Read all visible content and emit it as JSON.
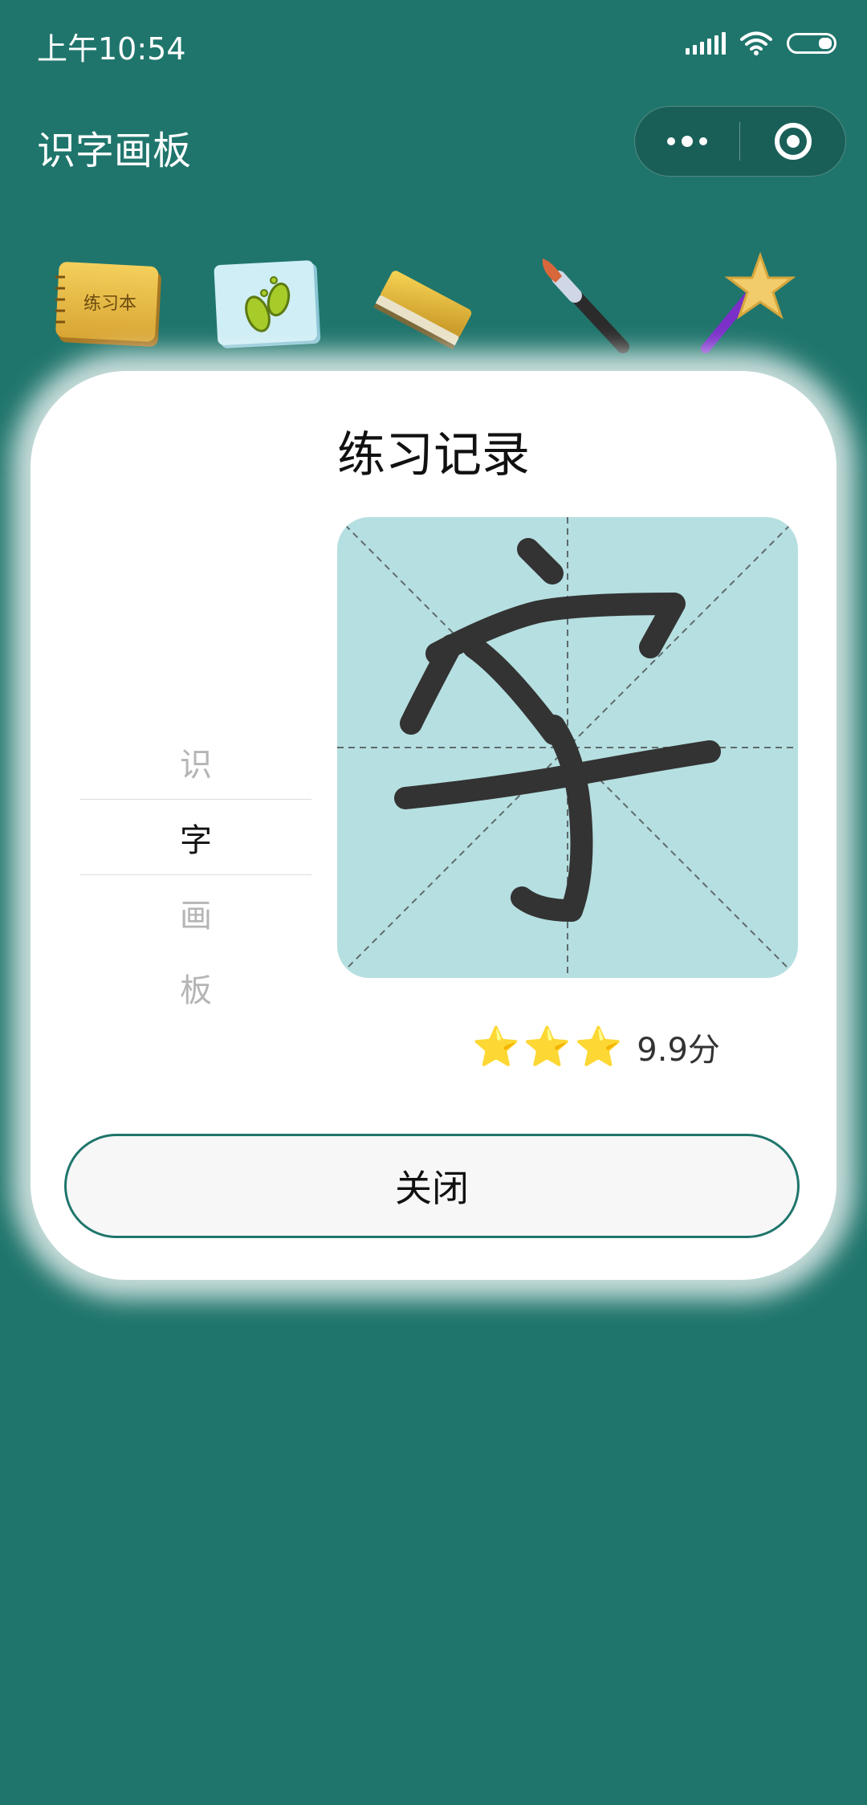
{
  "status_bar": {
    "time": "上午10:54",
    "icons": [
      "signal-icon",
      "wifi-icon",
      "battery-icon"
    ]
  },
  "nav": {
    "title": "识字画板",
    "capsule_icons": [
      "more-icon",
      "close-miniprogram-icon"
    ]
  },
  "toolbar": {
    "notebook_label": "练习本",
    "tools": [
      "notebook-icon",
      "footprints-icon",
      "eraser-icon",
      "brush-icon",
      "magic-wand-icon"
    ]
  },
  "dialog": {
    "title": "练习记录",
    "chars": [
      "识",
      "字",
      "画",
      "板"
    ],
    "selected_char": "字",
    "stars": 3,
    "score": "9.9分",
    "close_label": "关闭"
  },
  "colors": {
    "background": "#1f756c",
    "grid_fill": "#b6dfe1",
    "stroke": "#333333",
    "button_border": "#1f756c"
  }
}
